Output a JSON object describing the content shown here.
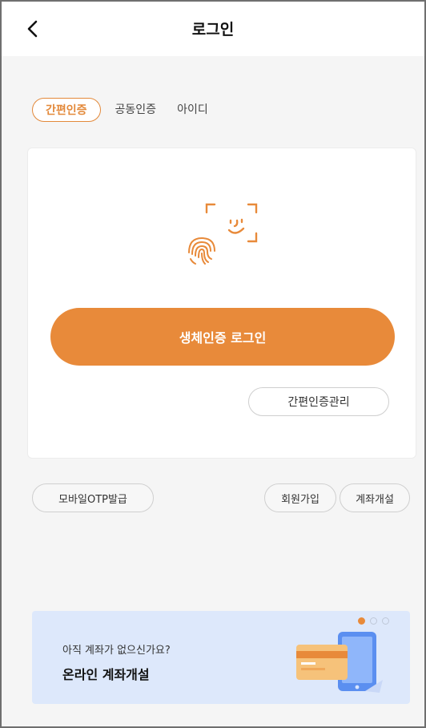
{
  "header": {
    "title": "로그인"
  },
  "tabs": [
    {
      "label": "간편인증",
      "active": true
    },
    {
      "label": "공동인증",
      "active": false
    },
    {
      "label": "아이디",
      "active": false
    }
  ],
  "card": {
    "biometric_login_label": "생체인증 로그인",
    "manage_label": "간편인증관리"
  },
  "actions": {
    "otp_label": "모바일OTP발급",
    "signup_label": "회원가입",
    "open_account_label": "계좌개설"
  },
  "banner": {
    "subtitle": "아직 계좌가 없으신가요?",
    "title": "온라인 계좌개설",
    "pages": 3,
    "active_page": 1
  },
  "colors": {
    "accent": "#e88a3a",
    "banner_bg": "#dde8fb",
    "page_bg": "#f5f5f5"
  },
  "icons": [
    "back-chevron-icon",
    "face-id-icon",
    "fingerprint-icon",
    "phone-card-icon"
  ]
}
